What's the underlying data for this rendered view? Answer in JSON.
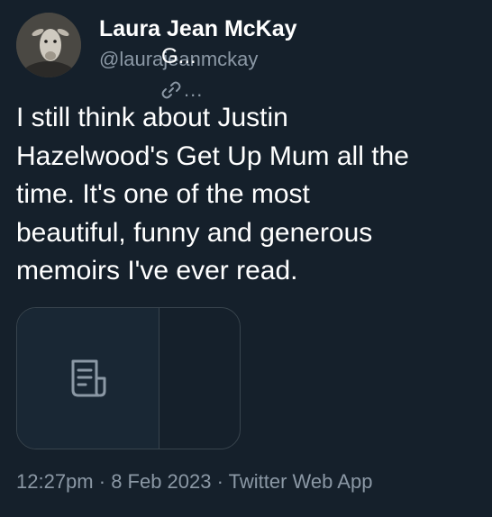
{
  "author": {
    "name": "Laura Jean McKay",
    "handle": "@laurajeanmckay",
    "avatar_icon": "avatar-photo-icon"
  },
  "tweet": {
    "text_lines": [
      "I still think about Justin",
      "Hazelwood's Get Up Mum all the",
      "time. It's one of the most",
      "beautiful, funny and generous",
      "memoirs I've ever read."
    ]
  },
  "card": {
    "title": "G...",
    "domain": "...",
    "media_icon": "document-icon",
    "link_icon": "link-icon"
  },
  "meta": {
    "time": "12:27pm",
    "sep1": " · ",
    "date": "8 Feb 2023",
    "sep2": " · ",
    "source": "Twitter Web App"
  },
  "colors": {
    "background": "#15202b",
    "text_primary": "#ffffff",
    "text_secondary": "#8b98a5",
    "border": "#38444d"
  }
}
